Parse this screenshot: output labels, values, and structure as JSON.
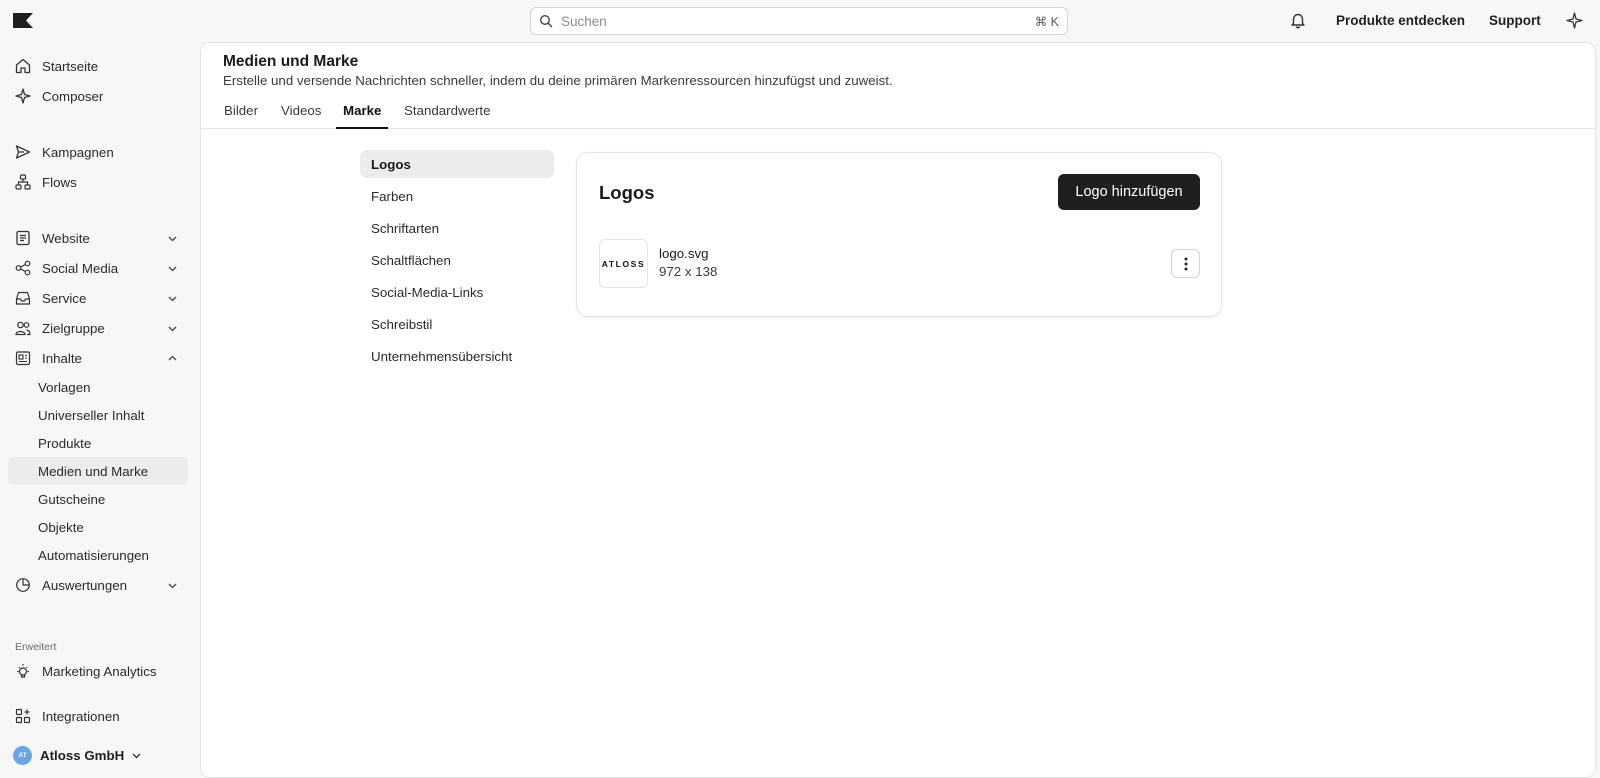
{
  "topbar": {
    "search_placeholder": "Suchen",
    "search_shortcut": "⌘ K",
    "discover_label": "Produkte entdecken",
    "support_label": "Support"
  },
  "sidebar": {
    "primary": [
      {
        "label": "Startseite",
        "icon": "home-icon"
      },
      {
        "label": "Composer",
        "icon": "sparkle-icon"
      }
    ],
    "campaigns": [
      {
        "label": "Kampagnen",
        "icon": "send-icon"
      },
      {
        "label": "Flows",
        "icon": "flow-icon"
      }
    ],
    "channels": [
      {
        "label": "Website",
        "icon": "page-icon"
      },
      {
        "label": "Social Media",
        "icon": "share-icon"
      },
      {
        "label": "Service",
        "icon": "inbox-icon"
      },
      {
        "label": "Zielgruppe",
        "icon": "users-icon"
      },
      {
        "label": "Inhalte",
        "icon": "content-icon"
      }
    ],
    "content_sub": [
      {
        "label": "Vorlagen"
      },
      {
        "label": "Universeller Inhalt"
      },
      {
        "label": "Produkte"
      },
      {
        "label": "Medien und Marke"
      },
      {
        "label": "Gutscheine"
      },
      {
        "label": "Objekte"
      },
      {
        "label": "Automatisierungen"
      }
    ],
    "reports": {
      "label": "Auswertungen",
      "icon": "chart-pie-icon"
    },
    "advanced_label": "Erweitert",
    "analytics": {
      "label": "Marketing Analytics",
      "icon": "bulb-icon"
    },
    "integrations": {
      "label": "Integrationen",
      "icon": "grid-plus-icon"
    },
    "account": {
      "initials": "AT",
      "name": "Atloss GmbH"
    }
  },
  "page": {
    "title": "Medien und Marke",
    "subtitle": "Erstelle und versende Nachrichten schneller, indem du deine primären Markenressourcen hinzufügst und zuweist.",
    "tabs": [
      "Bilder",
      "Videos",
      "Marke",
      "Standardwerte"
    ],
    "active_tab": "Marke"
  },
  "brand_nav": [
    "Logos",
    "Farben",
    "Schriftarten",
    "Schaltflächen",
    "Social-Media-Links",
    "Schreibstil",
    "Unternehmensübersicht"
  ],
  "logos_card": {
    "title": "Logos",
    "add_button": "Logo hinzufügen",
    "file": {
      "thumb_text": "ATLOSS",
      "name": "logo.svg",
      "dimensions": "972 x 138"
    }
  }
}
